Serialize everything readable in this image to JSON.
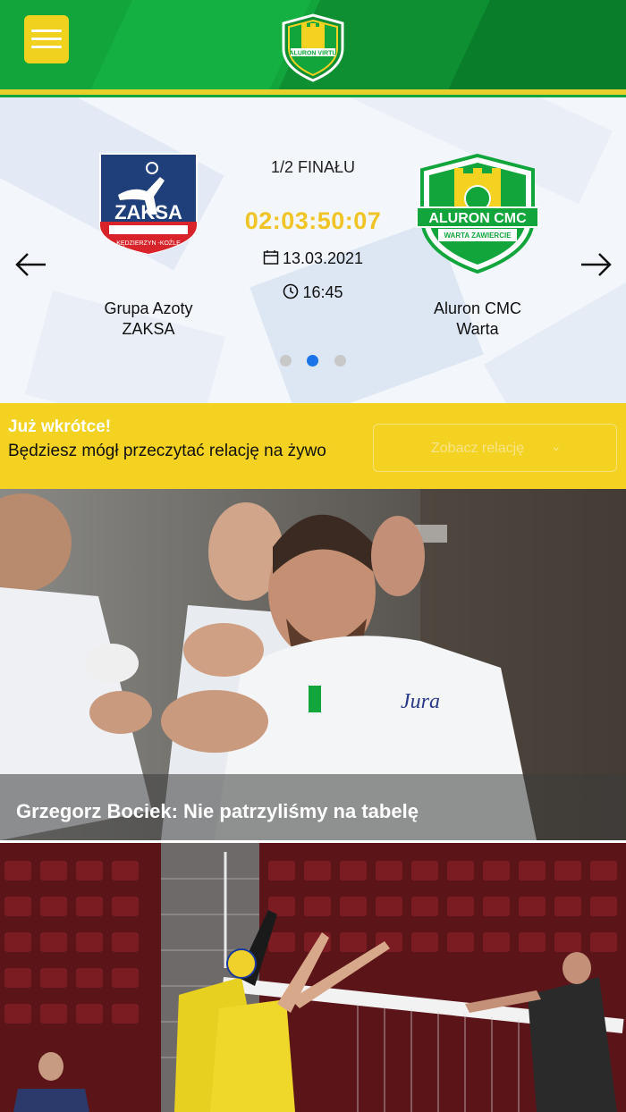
{
  "header": {
    "menu_icon": "hamburger-menu-icon",
    "logo": "aluron-virtu-club-logo"
  },
  "match": {
    "phase": "1/2 FINAŁU",
    "countdown": "02:03:50:07",
    "date": "13.03.2021",
    "time": "16:45",
    "home_team": {
      "line1": "Grupa Azoty",
      "line2": "ZAKSA",
      "logo_text": "ZAKSA",
      "logo_subtext": "KĘDZIERZYN -KOŹLE"
    },
    "away_team": {
      "line1": "Aluron CMC",
      "line2": "Warta",
      "logo_text": "ALURON CMC",
      "logo_subtext": "WARTA ZAWIERCIE"
    },
    "carousel": {
      "total": 3,
      "active": 2
    }
  },
  "banner": {
    "title": "Już wkrótce!",
    "text": "Będziesz mógł przeczytać relację na żywo",
    "button_label": "Zobacz relację"
  },
  "news": [
    {
      "title": "Grzegorz Bociek: Nie patrzyliśmy na tabelę"
    }
  ],
  "colors": {
    "brand_green": "#11a53c",
    "brand_yellow": "#f4d222",
    "countdown_yellow": "#f0c425",
    "dot_active": "#1a73e8"
  }
}
